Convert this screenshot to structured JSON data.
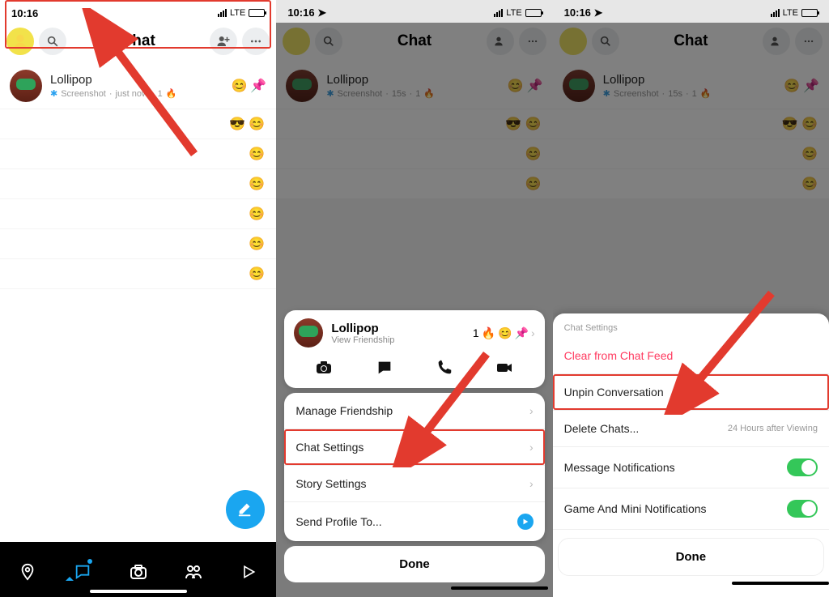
{
  "status": {
    "time": "10:16",
    "net": "LTE"
  },
  "header": {
    "title": "Chat"
  },
  "chat": {
    "name": "Lollipop",
    "sub1_action": "Screenshot",
    "sub1_time_now": "just now",
    "sub1_time_15s": "15s",
    "streak": "1",
    "fire": "🔥",
    "emoji_face": "😊",
    "pin": "📌"
  },
  "placeholder_emojis": {
    "row1": "😎 😊",
    "row2": "😊",
    "row3": "😊",
    "row4": "😊"
  },
  "profile_card": {
    "name": "Lollipop",
    "sub": "View Friendship",
    "right_count": "1"
  },
  "menu": {
    "manage": "Manage Friendship",
    "chat_settings": "Chat Settings",
    "story_settings": "Story Settings",
    "send_profile": "Send Profile To..."
  },
  "done": "Done",
  "settings": {
    "section": "Chat Settings",
    "clear": "Clear from Chat Feed",
    "unpin": "Unpin Conversation",
    "delete": "Delete Chats...",
    "delete_detail": "24 Hours after Viewing",
    "msg_notif": "Message Notifications",
    "game_notif": "Game And Mini Notifications"
  }
}
